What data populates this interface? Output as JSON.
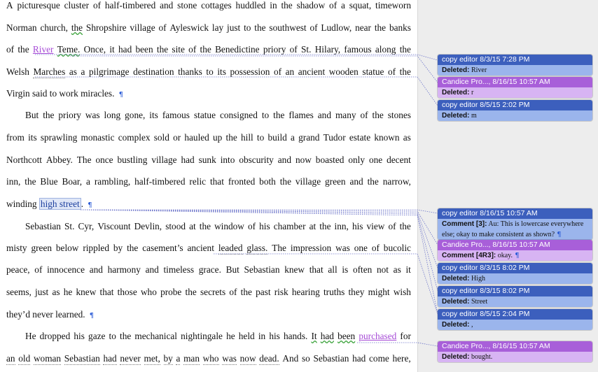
{
  "document": {
    "lines": [
      {
        "words": [
          "A",
          "picturesque",
          "cluster",
          "of",
          "half-timbered",
          "and",
          "stone",
          "cottages",
          "huddled",
          "in",
          "the",
          "shadow",
          "of",
          "a",
          "squat,",
          "timeworn"
        ]
      },
      {
        "words": [
          "Norman",
          "church,",
          "the",
          "Shropshire",
          "village",
          "of",
          "Ayleswick",
          "lay",
          "just",
          "to",
          "the",
          "southwest",
          "of",
          "Ludlow,",
          "near",
          "the",
          "banks"
        ]
      },
      {
        "words": [
          "of",
          "the",
          "River",
          "Teme.",
          "Once,",
          "it",
          "had",
          "been",
          "the",
          "site",
          "of",
          "the",
          "Benedictine",
          "priory",
          "of",
          "St.",
          "Hilary,",
          "famous",
          "along",
          "the"
        ]
      },
      {
        "words": [
          "Welsh",
          "Marches",
          "as",
          "a",
          "pilgrimage",
          "destination",
          "thanks",
          "to",
          "its",
          "possession",
          "of",
          "an",
          "ancient",
          "wooden",
          "statue",
          "of",
          "the"
        ]
      },
      {
        "text": "Virgin said to work miracles.",
        "mark": "¶"
      },
      {
        "words": [
          "But",
          "the",
          "priory",
          "was",
          "long",
          "gone,",
          "its",
          "famous",
          "statue",
          "consigned",
          "to",
          "the",
          "flames",
          "and",
          "many",
          "of",
          "the",
          "stones"
        ]
      },
      {
        "words": [
          "from",
          "its",
          "sprawling",
          "monastic",
          "complex",
          "sold",
          "or",
          "hauled",
          "up",
          "the",
          "hill",
          "to",
          "build",
          "a",
          "grand",
          "Tudor",
          "estate",
          "known",
          "as"
        ]
      },
      {
        "words": [
          "Northcott",
          "Abbey.",
          "The",
          "once",
          "bustling",
          "village",
          "had",
          "sunk",
          "into",
          "obscurity",
          "and",
          "now",
          "boasted",
          "only",
          "one",
          "decent"
        ]
      },
      {
        "words": [
          "inn,",
          "the",
          "Blue",
          "Boar,",
          "a",
          "rambling,",
          "half-timbered",
          "relic",
          "that",
          "fronted",
          "both",
          "the",
          "village",
          "green",
          "and",
          "the",
          "narrow,"
        ]
      },
      {
        "text": "winding",
        "highlight": "high street",
        "tail": ".",
        "mark": "¶"
      },
      {
        "words": [
          "Sebastian",
          "St.",
          "Cyr,",
          "Viscount",
          "Devlin,",
          "stood",
          "at",
          "the",
          "window",
          "of",
          "his",
          "chamber",
          "at",
          "the",
          "inn,",
          "his",
          "view",
          "of",
          "the"
        ]
      },
      {
        "words": [
          "misty",
          "green",
          "below",
          "rippled",
          "by",
          "the",
          "casement’s",
          "ancient",
          "leaded",
          "glass.",
          "The",
          "impression",
          "was",
          "one",
          "of",
          "bucolic"
        ]
      },
      {
        "words": [
          "peace,",
          "of",
          "innocence",
          "and",
          "harmony",
          "and",
          "timeless",
          "grace.",
          "But",
          "Sebastian",
          "knew",
          "that",
          "all",
          "is",
          "often",
          "not",
          "as",
          "it"
        ]
      },
      {
        "words": [
          "seems,",
          "just",
          "as",
          "he",
          "knew",
          "that",
          "those",
          "who",
          "probe",
          "the",
          "secrets",
          "of",
          "the",
          "past",
          "risk",
          "hearing",
          "truths",
          "they",
          "might",
          "wish"
        ]
      },
      {
        "text": "they’d never learned.",
        "mark": "¶"
      },
      {
        "words": [
          "He",
          "dropped",
          "his",
          "gaze",
          "to",
          "the",
          "mechanical",
          "nightingale",
          "he",
          "held",
          "in",
          "his",
          "hands.",
          "It",
          "had",
          "been",
          "purchased",
          "for"
        ]
      },
      {
        "words": [
          "an",
          "old",
          "woman",
          "Sebastian",
          "had",
          "never",
          "met,",
          "by",
          "a",
          "man",
          "who",
          "was",
          "now",
          "dead.",
          "And",
          "so",
          "Sebastian",
          "had",
          "come",
          "here,"
        ]
      }
    ]
  },
  "balloons": [
    {
      "header": "copy editor 8/3/15 7:28 PM",
      "label": "Deleted:",
      "text": "River",
      "color": "blue"
    },
    {
      "header": "Candice Pro..., 8/16/15 10:57 AM",
      "label": "Deleted:",
      "text": "r",
      "color": "purple"
    },
    {
      "header": "copy editor 8/5/15 2:02 PM",
      "label": "Deleted:",
      "text": "m",
      "color": "blue"
    },
    {
      "header": "copy editor 8/16/15 10:57 AM",
      "label": "Comment [3]:",
      "text": "Au: This is lowercase everywhere",
      "text2": "else; okay to make consistent as shown?",
      "mark": "¶",
      "color": "blue"
    },
    {
      "header": "Candice Pro..., 8/16/15 10:57 AM",
      "label": "Comment [4R3]:",
      "text": "okay.",
      "mark": "¶",
      "color": "purple"
    },
    {
      "header": "copy editor 8/3/15 8:02 PM",
      "label": "Deleted:",
      "text": "High",
      "color": "blue"
    },
    {
      "header": "copy editor 8/3/15 8:02 PM",
      "label": "Deleted:",
      "text": "Street",
      "color": "blue"
    },
    {
      "header": "copy editor 8/5/15 2:04 PM",
      "label": "Deleted:",
      "text": ",",
      "color": "blue"
    },
    {
      "header": "Candice Pro..., 8/16/15 10:57 AM",
      "label": "Deleted:",
      "text": "bought.",
      "color": "purple"
    }
  ],
  "colors": {
    "copy_editor": "#3c5fbd",
    "candice": "#a85fd9",
    "pilcrow": "#2a5bd7"
  }
}
